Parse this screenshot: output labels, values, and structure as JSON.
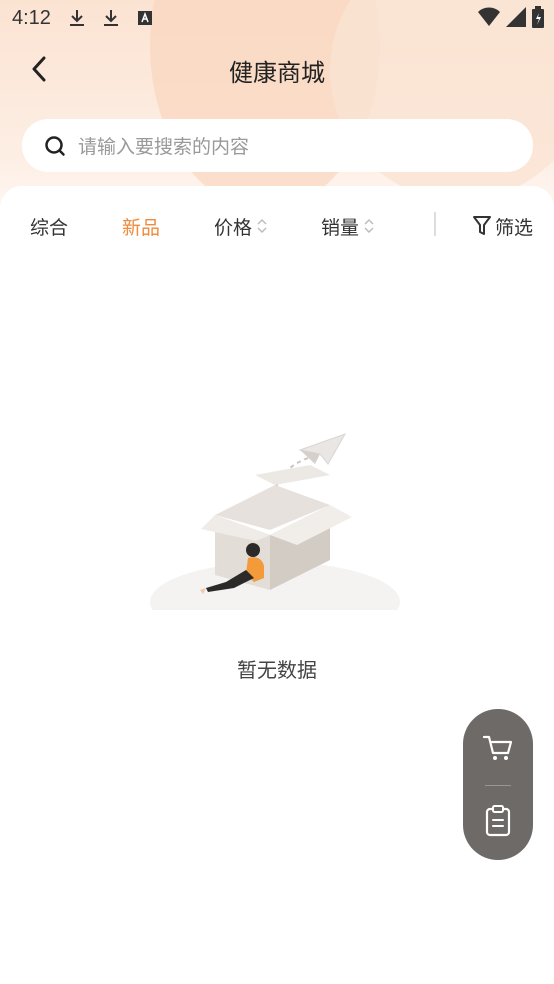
{
  "status_bar": {
    "time": "4:12"
  },
  "header": {
    "title": "健康商城"
  },
  "search": {
    "placeholder": "请输入要搜索的内容"
  },
  "tabs": [
    {
      "label": "综合",
      "active": false
    },
    {
      "label": "新品",
      "active": true
    },
    {
      "label": "价格",
      "sortable": true
    },
    {
      "label": "销量",
      "sortable": true
    }
  ],
  "filter": {
    "label": "筛选"
  },
  "empty_state": {
    "text": "暂无数据"
  },
  "colors": {
    "accent": "#f08a3c",
    "float_bar": "#6e6a67"
  },
  "icons": [
    "back-arrow-icon",
    "search-icon",
    "sort-arrows-icon",
    "filter-icon",
    "cart-icon",
    "clipboard-icon"
  ]
}
